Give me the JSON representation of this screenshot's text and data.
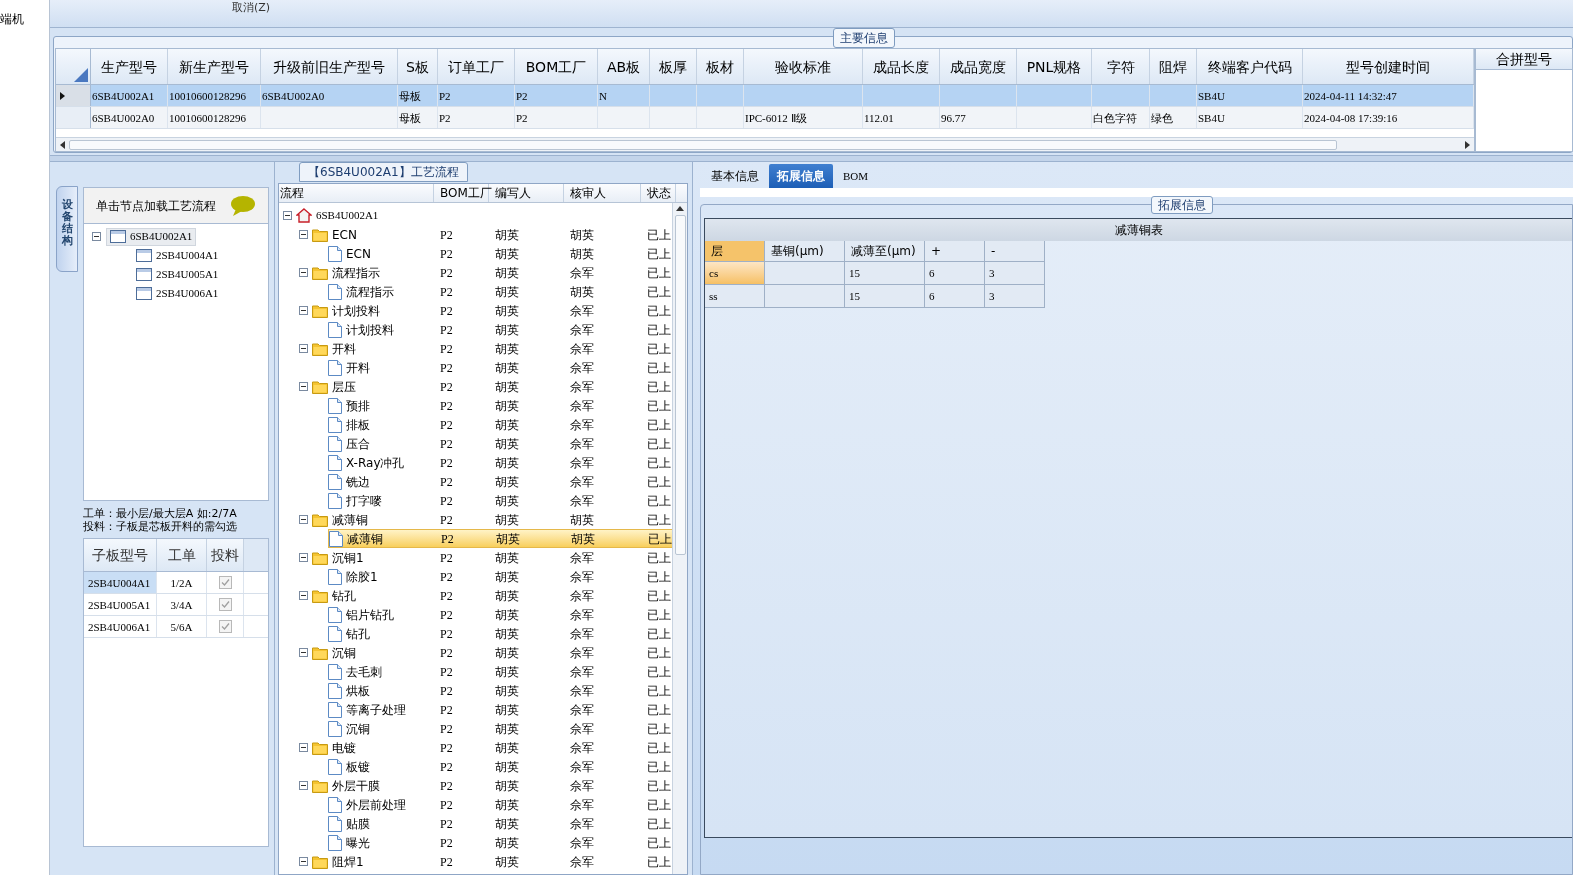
{
  "left_strip": {
    "text": "端机"
  },
  "toolbar": {
    "button": "取消(Z)"
  },
  "main_info": {
    "title": "主要信息",
    "columns": [
      "生产型号",
      "新生产型号",
      "升级前旧生产型号",
      "S板",
      "订单工厂",
      "BOM工厂",
      "AB板",
      "板厚",
      "板材",
      "验收标准",
      "成品长度",
      "成品宽度",
      "PNL规格",
      "字符",
      "阻焊",
      "终端客户代码",
      "型号创建时间"
    ],
    "rows": [
      {
        "selected": true,
        "cells": [
          "6SB4U002A1",
          "10010600128296",
          "6SB4U002A0",
          "母板",
          "P2",
          "P2",
          "N",
          null,
          null,
          null,
          null,
          null,
          null,
          null,
          null,
          "SB4U",
          "2024-04-11 14:32:47"
        ]
      },
      {
        "selected": false,
        "cells": [
          "6SB4U002A0",
          "10010600128296",
          null,
          "母板",
          "P2",
          "P2",
          null,
          null,
          null,
          "IPC-6012 Ⅱ级",
          "112.01",
          "96.77",
          null,
          "白色字符",
          "绿色",
          "SB4U",
          "2024-04-08 17:39:16"
        ]
      }
    ],
    "side_column": "合拼型号"
  },
  "structure_panel": {
    "vertical_tab": "设备结构",
    "hint": "单击节点加载工艺流程",
    "tree": {
      "label": "6SB4U002A1",
      "selected": true,
      "expanded": true,
      "children": [
        {
          "label": "2SB4U004A1",
          "selected": false
        },
        {
          "label": "2SB4U005A1",
          "selected": false
        },
        {
          "label": "2SB4U006A1",
          "selected": false
        }
      ]
    },
    "notes": [
      "工单：最小层/最大层A 如:2/7A",
      "投料：子板是芯板开料的需勾选"
    ],
    "sub_table": {
      "columns": [
        "子板型号",
        "工单",
        "投料"
      ],
      "rows": [
        {
          "selected": true,
          "cells": [
            "2SB4U004A1",
            "1/2A"
          ],
          "checked": true
        },
        {
          "selected": false,
          "cells": [
            "2SB4U005A1",
            "3/4A"
          ],
          "checked": true
        },
        {
          "selected": false,
          "cells": [
            "2SB4U006A1",
            "5/6A"
          ],
          "checked": true
        }
      ]
    }
  },
  "process": {
    "title": "【6SB4U002A1】工艺流程",
    "columns": [
      "流程",
      "BOM工厂",
      "编写人",
      "核审人",
      "状态"
    ],
    "tree": {
      "label": "6SB4U002A1",
      "expanded": true,
      "selected": false,
      "children": [
        {
          "label": "ECN",
          "bom": "P2",
          "writer": "胡英",
          "reviewer": "胡英",
          "status": "已上",
          "expanded": true,
          "selected": false,
          "children": [
            {
              "label": "ECN",
              "bom": "P2",
              "writer": "胡英",
              "reviewer": "胡英",
              "status": "已上",
              "selected": false
            }
          ]
        },
        {
          "label": "流程指示",
          "bom": "P2",
          "writer": "胡英",
          "reviewer": "佘军",
          "status": "已上",
          "expanded": true,
          "selected": false,
          "children": [
            {
              "label": "流程指示",
              "bom": "P2",
              "writer": "胡英",
              "reviewer": "胡英",
              "status": "已上",
              "selected": false
            }
          ]
        },
        {
          "label": "计划投料",
          "bom": "P2",
          "writer": "胡英",
          "reviewer": "佘军",
          "status": "已上",
          "expanded": true,
          "selected": false,
          "children": [
            {
              "label": "计划投料",
              "bom": "P2",
              "writer": "胡英",
              "reviewer": "佘军",
              "status": "已上",
              "selected": false
            }
          ]
        },
        {
          "label": "开料",
          "bom": "P2",
          "writer": "胡英",
          "reviewer": "佘军",
          "status": "已上",
          "expanded": true,
          "selected": false,
          "children": [
            {
              "label": "开料",
              "bom": "P2",
              "writer": "胡英",
              "reviewer": "佘军",
              "status": "已上",
              "selected": false
            }
          ]
        },
        {
          "label": "层压",
          "bom": "P2",
          "writer": "胡英",
          "reviewer": "佘军",
          "status": "已上",
          "expanded": true,
          "selected": false,
          "children": [
            {
              "label": "预排",
              "bom": "P2",
              "writer": "胡英",
              "reviewer": "佘军",
              "status": "已上",
              "selected": false
            },
            {
              "label": "排板",
              "bom": "P2",
              "writer": "胡英",
              "reviewer": "佘军",
              "status": "已上",
              "selected": false
            },
            {
              "label": "压合",
              "bom": "P2",
              "writer": "胡英",
              "reviewer": "佘军",
              "status": "已上",
              "selected": false
            },
            {
              "label": "X-Ray冲孔",
              "bom": "P2",
              "writer": "胡英",
              "reviewer": "佘军",
              "status": "已上",
              "selected": false
            },
            {
              "label": "铣边",
              "bom": "P2",
              "writer": "胡英",
              "reviewer": "佘军",
              "status": "已上",
              "selected": false
            },
            {
              "label": "打字嘜",
              "bom": "P2",
              "writer": "胡英",
              "reviewer": "佘军",
              "status": "已上",
              "selected": false
            }
          ]
        },
        {
          "label": "减薄铜",
          "bom": "P2",
          "writer": "胡英",
          "reviewer": "胡英",
          "status": "已上",
          "expanded": true,
          "selected": false,
          "children": [
            {
              "label": "减薄铜",
              "bom": "P2",
              "writer": "胡英",
              "reviewer": "胡英",
              "status": "已上",
              "selected": true
            }
          ]
        },
        {
          "label": "沉铜1",
          "bom": "P2",
          "writer": "胡英",
          "reviewer": "佘军",
          "status": "已上",
          "expanded": true,
          "selected": false,
          "children": [
            {
              "label": "除胶1",
              "bom": "P2",
              "writer": "胡英",
              "reviewer": "佘军",
              "status": "已上",
              "selected": false
            }
          ]
        },
        {
          "label": "钻孔",
          "bom": "P2",
          "writer": "胡英",
          "reviewer": "佘军",
          "status": "已上",
          "expanded": true,
          "selected": false,
          "children": [
            {
              "label": "铝片钻孔",
              "bom": "P2",
              "writer": "胡英",
              "reviewer": "佘军",
              "status": "已上",
              "selected": false
            },
            {
              "label": "钻孔",
              "bom": "P2",
              "writer": "胡英",
              "reviewer": "佘军",
              "status": "已上",
              "selected": false
            }
          ]
        },
        {
          "label": "沉铜",
          "bom": "P2",
          "writer": "胡英",
          "reviewer": "佘军",
          "status": "已上",
          "expanded": true,
          "selected": false,
          "children": [
            {
              "label": "去毛刺",
              "bom": "P2",
              "writer": "胡英",
              "reviewer": "佘军",
              "status": "已上",
              "selected": false
            },
            {
              "label": "烘板",
              "bom": "P2",
              "writer": "胡英",
              "reviewer": "佘军",
              "status": "已上",
              "selected": false
            },
            {
              "label": "等离子处理",
              "bom": "P2",
              "writer": "胡英",
              "reviewer": "佘军",
              "status": "已上",
              "selected": false
            },
            {
              "label": "沉铜",
              "bom": "P2",
              "writer": "胡英",
              "reviewer": "佘军",
              "status": "已上",
              "selected": false
            }
          ]
        },
        {
          "label": "电镀",
          "bom": "P2",
          "writer": "胡英",
          "reviewer": "佘军",
          "status": "已上",
          "expanded": true,
          "selected": false,
          "children": [
            {
              "label": "板镀",
              "bom": "P2",
              "writer": "胡英",
              "reviewer": "佘军",
              "status": "已上",
              "selected": false
            }
          ]
        },
        {
          "label": "外层干膜",
          "bom": "P2",
          "writer": "胡英",
          "reviewer": "佘军",
          "status": "已上",
          "expanded": true,
          "selected": false,
          "children": [
            {
              "label": "外层前处理",
              "bom": "P2",
              "writer": "胡英",
              "reviewer": "佘军",
              "status": "已上",
              "selected": false
            },
            {
              "label": "贴膜",
              "bom": "P2",
              "writer": "胡英",
              "reviewer": "佘军",
              "status": "已上",
              "selected": false
            },
            {
              "label": "曝光",
              "bom": "P2",
              "writer": "胡英",
              "reviewer": "佘军",
              "status": "已上",
              "selected": false
            }
          ]
        },
        {
          "label": "阻焊1",
          "bom": "P2",
          "writer": "胡英",
          "reviewer": "佘军",
          "status": "已上",
          "expanded": true,
          "selected": false
        }
      ]
    }
  },
  "detail": {
    "tabs": [
      {
        "label": "基本信息",
        "selected": false
      },
      {
        "label": "拓展信息",
        "selected": true
      },
      {
        "label": "BOM",
        "selected": false
      }
    ],
    "group_title": "拓展信息",
    "table": {
      "title": "减薄铜表",
      "columns": [
        "层",
        "基铜(μm)",
        "减薄至(μm)",
        "+",
        "-"
      ],
      "rows": [
        {
          "selected": true,
          "cells": [
            "cs",
            null,
            "15",
            "6",
            "3"
          ]
        },
        {
          "selected": false,
          "cells": [
            "ss",
            null,
            "15",
            "6",
            "3"
          ]
        }
      ]
    }
  }
}
